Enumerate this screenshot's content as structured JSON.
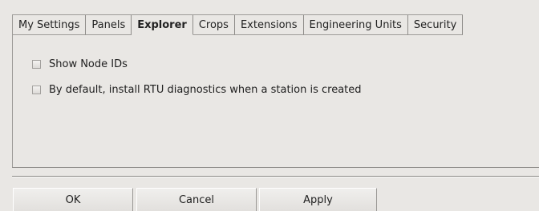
{
  "tabs": [
    {
      "label": "My Settings",
      "active": false
    },
    {
      "label": "Panels",
      "active": false
    },
    {
      "label": "Explorer",
      "active": true
    },
    {
      "label": "Crops",
      "active": false
    },
    {
      "label": "Extensions",
      "active": false
    },
    {
      "label": "Engineering Units",
      "active": false
    },
    {
      "label": "Security",
      "active": false
    }
  ],
  "explorer": {
    "options": [
      {
        "label": "Show Node IDs",
        "checked": false
      },
      {
        "label": "By default, install RTU diagnostics when a station is created",
        "checked": false
      }
    ]
  },
  "buttons": {
    "ok": "OK",
    "cancel": "Cancel",
    "apply": "Apply"
  },
  "icons": {
    "checkbox": "unchecked-checkbox-icon"
  }
}
